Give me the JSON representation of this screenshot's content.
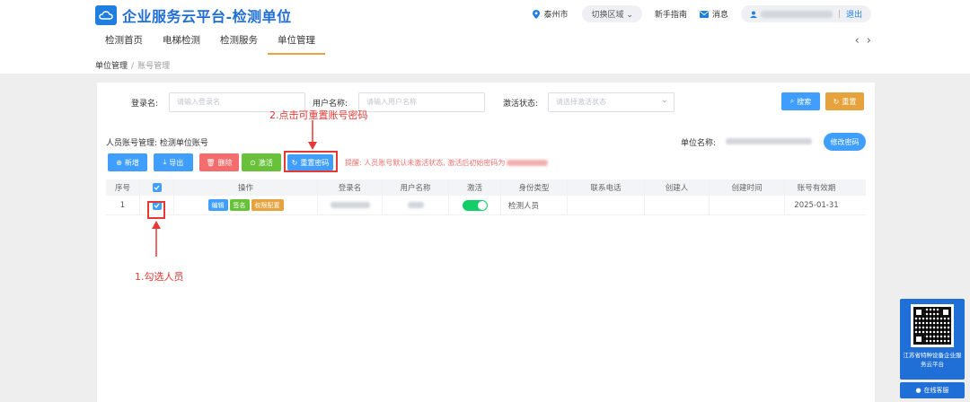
{
  "header": {
    "title": "企业服务云平台-检测单位",
    "city": "泰州市",
    "switch_area": "切换区域",
    "guide": "新手指南",
    "message": "消息",
    "logout": "退出"
  },
  "nav": {
    "items": [
      {
        "label": "检测首页"
      },
      {
        "label": "电梯检测"
      },
      {
        "label": "检测服务"
      },
      {
        "label": "单位管理"
      }
    ]
  },
  "breadcrumb": {
    "parent": "单位管理",
    "sep": "/",
    "current": "账号管理"
  },
  "filters": {
    "login_label": "登录名:",
    "login_placeholder": "请输入登录名",
    "user_label": "用户名称:",
    "user_placeholder": "请输入用户名称",
    "status_label": "激活状态:",
    "status_placeholder": "请选择激活状态",
    "search": "搜索",
    "reset": "重置"
  },
  "section": {
    "title": "人员账号管理: 检测单位账号",
    "unit_label": "单位名称:",
    "change_pwd": "修改密码"
  },
  "toolbar": {
    "add": "新增",
    "export": "导出",
    "delete": "删除",
    "activate": "激活",
    "reset_pwd": "重置密码",
    "notice": "提醒: 人员账号默认未激活状态, 激活后初始密码为"
  },
  "table": {
    "columns": [
      "序号",
      "",
      "操作",
      "登录名",
      "用户名称",
      "激活",
      "身份类型",
      "联系电话",
      "创建人",
      "创建时间",
      "账号有效期"
    ],
    "rows": [
      {
        "index": "1",
        "edit": "编辑",
        "sign": "签名",
        "perm": "权限配置",
        "identity": "检测人员",
        "expiry": "2025-01-31",
        "active": true
      }
    ]
  },
  "annotations": {
    "step1": "1.勾选人员",
    "step2": "2.点击可重置账号密码"
  },
  "side": {
    "text": "江苏省特种设备企业服务云平台",
    "chat": "在线客服"
  },
  "colors": {
    "primary": "#409eff",
    "orange": "#e6a23c",
    "danger": "#f56c6c",
    "success": "#67c23a",
    "annotation": "#e53935"
  }
}
